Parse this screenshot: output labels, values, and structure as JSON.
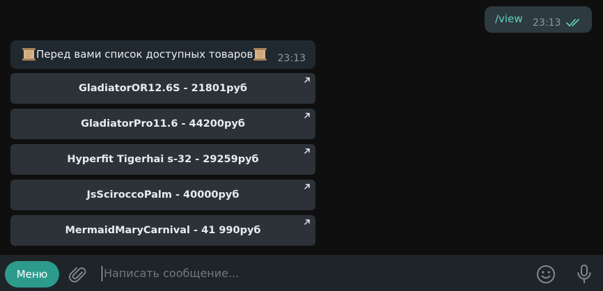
{
  "outgoing": {
    "text": "/view",
    "time": "23:13",
    "status_icon": "double-check-icon"
  },
  "incoming": {
    "text": "Перед вами список доступных товаров",
    "time": "23:13",
    "decor_icon": "scroll-icon"
  },
  "keyboard": {
    "buttons": [
      {
        "label": "GladiatorOR12.6S - 21801руб"
      },
      {
        "label": "GladiatorPro11.6 - 44200руб"
      },
      {
        "label": "Hyperfit Tigerhai s-32 - 29259руб"
      },
      {
        "label": "JsSciroccoPalm - 40000руб"
      },
      {
        "label": "MermaidMaryCarnival - 41 990руб"
      }
    ],
    "button_icon": "external-arrow-icon"
  },
  "composer": {
    "menu_label": "Меню",
    "placeholder": "Написать сообщение...",
    "attach_icon": "paperclip-icon",
    "emoji_icon": "emoji-icon",
    "mic_icon": "microphone-icon"
  },
  "colors": {
    "accent": "#2c9b8c",
    "outgoing_text": "#5fd2c1"
  }
}
